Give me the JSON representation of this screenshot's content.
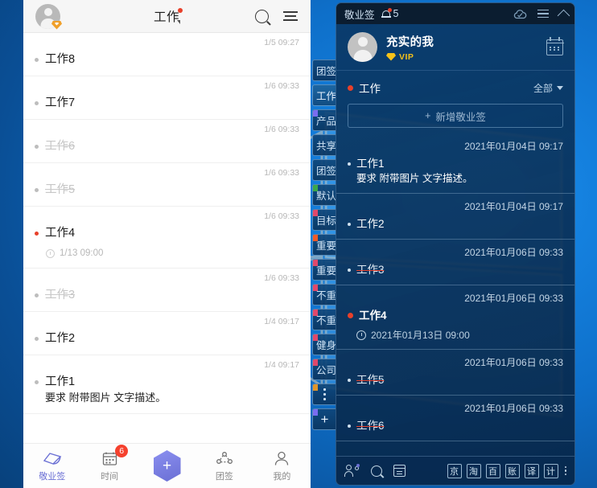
{
  "desktop": {
    "wallpaper": "windows-logo",
    "bg_color": "#0a4f96"
  },
  "phone": {
    "header": {
      "title": "工作",
      "avatar_icon": "avatar-icon",
      "vip_badge_icon": "vip-badge-icon",
      "search_icon": "search-icon",
      "menu_icon": "menu-icon"
    },
    "notes": [
      {
        "time": "1/5 09:27",
        "text": "工作8",
        "done": false,
        "priority": false,
        "desc": "",
        "remind": ""
      },
      {
        "time": "1/6 09:33",
        "text": "工作7",
        "done": false,
        "priority": false,
        "desc": "",
        "remind": ""
      },
      {
        "time": "1/6 09:33",
        "text": "工作6",
        "done": true,
        "priority": false,
        "desc": "",
        "remind": ""
      },
      {
        "time": "1/6 09:33",
        "text": "工作5",
        "done": true,
        "priority": false,
        "desc": "",
        "remind": ""
      },
      {
        "time": "1/6 09:33",
        "text": "工作4",
        "done": false,
        "priority": true,
        "desc": "",
        "remind": "1/13 09:00"
      },
      {
        "time": "1/6 09:33",
        "text": "工作3",
        "done": true,
        "priority": false,
        "desc": "",
        "remind": ""
      },
      {
        "time": "1/4 09:17",
        "text": "工作2",
        "done": false,
        "priority": false,
        "desc": "",
        "remind": ""
      },
      {
        "time": "1/4 09:17",
        "text": "工作1",
        "done": false,
        "priority": false,
        "desc": "要求 附带图片 文字描述。",
        "remind": ""
      }
    ],
    "nav": [
      {
        "label": "敬业签",
        "icon": "note-icon",
        "badge": "",
        "active": true
      },
      {
        "label": "时间",
        "icon": "calendar-icon",
        "badge": "6",
        "active": false
      },
      {
        "label": "",
        "icon": "add-icon",
        "badge": "",
        "active": false
      },
      {
        "label": "团签",
        "icon": "group-icon",
        "badge": "",
        "active": false
      },
      {
        "label": "我的",
        "icon": "person-icon",
        "badge": "",
        "active": false
      }
    ]
  },
  "tab_strip": {
    "tabs": [
      {
        "label": "团签",
        "flag_color": "",
        "selected": false
      },
      {
        "label": "工作",
        "flag_color": "",
        "selected": true
      },
      {
        "label": "产品",
        "flag_color": "#7a6cf0",
        "selected": false
      },
      {
        "label": "共享",
        "flag_color": "",
        "selected": false
      },
      {
        "label": "团签",
        "flag_color": "",
        "selected": false
      },
      {
        "label": "默认",
        "flag_color": "#3aa84a",
        "selected": false
      },
      {
        "label": "目标",
        "flag_color": "#e0486b",
        "selected": false
      },
      {
        "label": "重要",
        "flag_color": "#f05a28",
        "selected": false
      },
      {
        "label": "重要",
        "flag_color": "#e0486b",
        "selected": false
      },
      {
        "label": "不重",
        "flag_color": "#e0486b",
        "selected": false
      },
      {
        "label": "不重",
        "flag_color": "#e0486b",
        "selected": false
      },
      {
        "label": "健身",
        "flag_color": "#e0486b",
        "selected": false
      },
      {
        "label": "公司",
        "flag_color": "#e0486b",
        "selected": false
      }
    ],
    "more_icon": "more-vertical-icon",
    "add_icon": "plus-icon"
  },
  "app": {
    "titlebar": {
      "title": "敬业签",
      "bell_icon": "bell-icon",
      "notification_count": "5",
      "cloud_icon": "cloud-sync-icon",
      "menu_icon": "hamburger-icon",
      "collapse_icon": "chevron-up-icon"
    },
    "user": {
      "name": "充实的我",
      "vip_label": "VIP",
      "vip_gem_icon": "gem-icon",
      "avatar_icon": "avatar-icon",
      "calendar_icon": "calendar-icon"
    },
    "category": {
      "name": "工作",
      "dot_color": "#e8402a",
      "filter_label": "全部",
      "caret_icon": "chevron-down-icon"
    },
    "add_button": {
      "label": "新增敬业签",
      "plus_icon": "plus-icon"
    },
    "notes": [
      {
        "time": "2021年01月04日 09:17",
        "text": "工作1",
        "desc": "要求 附带图片 文字描述。",
        "remind": "",
        "done": false,
        "priority": false
      },
      {
        "time": "2021年01月04日 09:17",
        "text": "工作2",
        "desc": "",
        "remind": "",
        "done": false,
        "priority": false
      },
      {
        "time": "2021年01月06日 09:33",
        "text": "工作3",
        "desc": "",
        "remind": "",
        "done": true,
        "priority": false
      },
      {
        "time": "2021年01月06日 09:33",
        "text": "工作4",
        "desc": "",
        "remind": "2021年01月13日 09:00",
        "done": false,
        "priority": true
      },
      {
        "time": "2021年01月06日 09:33",
        "text": "工作5",
        "desc": "",
        "remind": "",
        "done": true,
        "priority": false
      },
      {
        "time": "2021年01月06日 09:33",
        "text": "工作6",
        "desc": "",
        "remind": "",
        "done": true,
        "priority": false
      }
    ],
    "bottom_bar": {
      "left_icons": [
        {
          "name": "contacts-icon"
        },
        {
          "name": "search-icon"
        },
        {
          "name": "note-icon"
        }
      ],
      "shortcuts": [
        "京",
        "淘",
        "百",
        "账",
        "译",
        "计"
      ],
      "more_icon": "more-vertical-icon"
    }
  }
}
